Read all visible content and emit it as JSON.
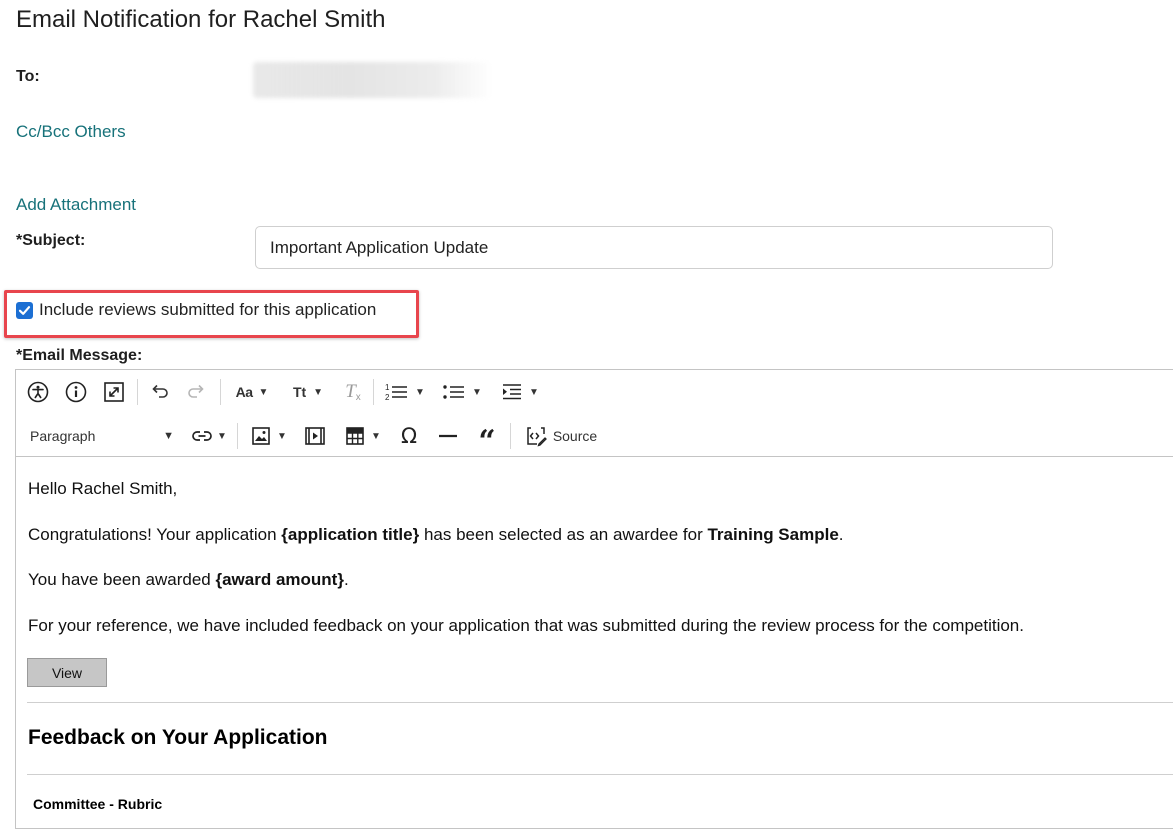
{
  "page": {
    "title": "Email Notification for Rachel Smith"
  },
  "form": {
    "to_label": "To:",
    "cc_bcc_link": "Cc/Bcc Others",
    "add_attachment_link": "Add Attachment",
    "subject_label": "*Subject:",
    "subject_value": "Important Application Update",
    "include_reviews_label": "Include reviews submitted for this application",
    "include_reviews_checked": true,
    "email_message_label": "*Email Message:"
  },
  "toolbar": {
    "row1": [
      "accessibility-icon",
      "info-icon",
      "maximize-icon",
      "undo-icon",
      "redo-icon",
      "font-family-icon",
      "font-size-icon",
      "remove-format-icon",
      "numbered-list-icon",
      "bulleted-list-icon",
      "indent-icon"
    ],
    "heading_select_value": "Paragraph",
    "row2": [
      "link-icon",
      "image-icon",
      "media-icon",
      "table-icon",
      "special-characters-icon",
      "horizontal-line-icon",
      "block-quote-icon",
      "source-icon"
    ],
    "source_label": "Source"
  },
  "message": {
    "greeting": "Hello Rachel Smith,",
    "line1_a": "Congratulations! Your application ",
    "line1_b": "{application title}",
    "line1_c": " has been selected as an awardee for ",
    "line1_d": "Training Sample",
    "line1_e": ".",
    "line2_a": "You have been awarded ",
    "line2_b": "{award amount}",
    "line2_c": ".",
    "line3": "For your reference, we have included feedback on your application that was submitted during the review process for the competition.",
    "view_button": "View",
    "feedback_heading": "Feedback on Your Application",
    "committee_label": "Committee - Rubric"
  },
  "colors": {
    "link": "#17727a",
    "checkbox": "#1c6fd3",
    "highlight": "#e8454d"
  }
}
